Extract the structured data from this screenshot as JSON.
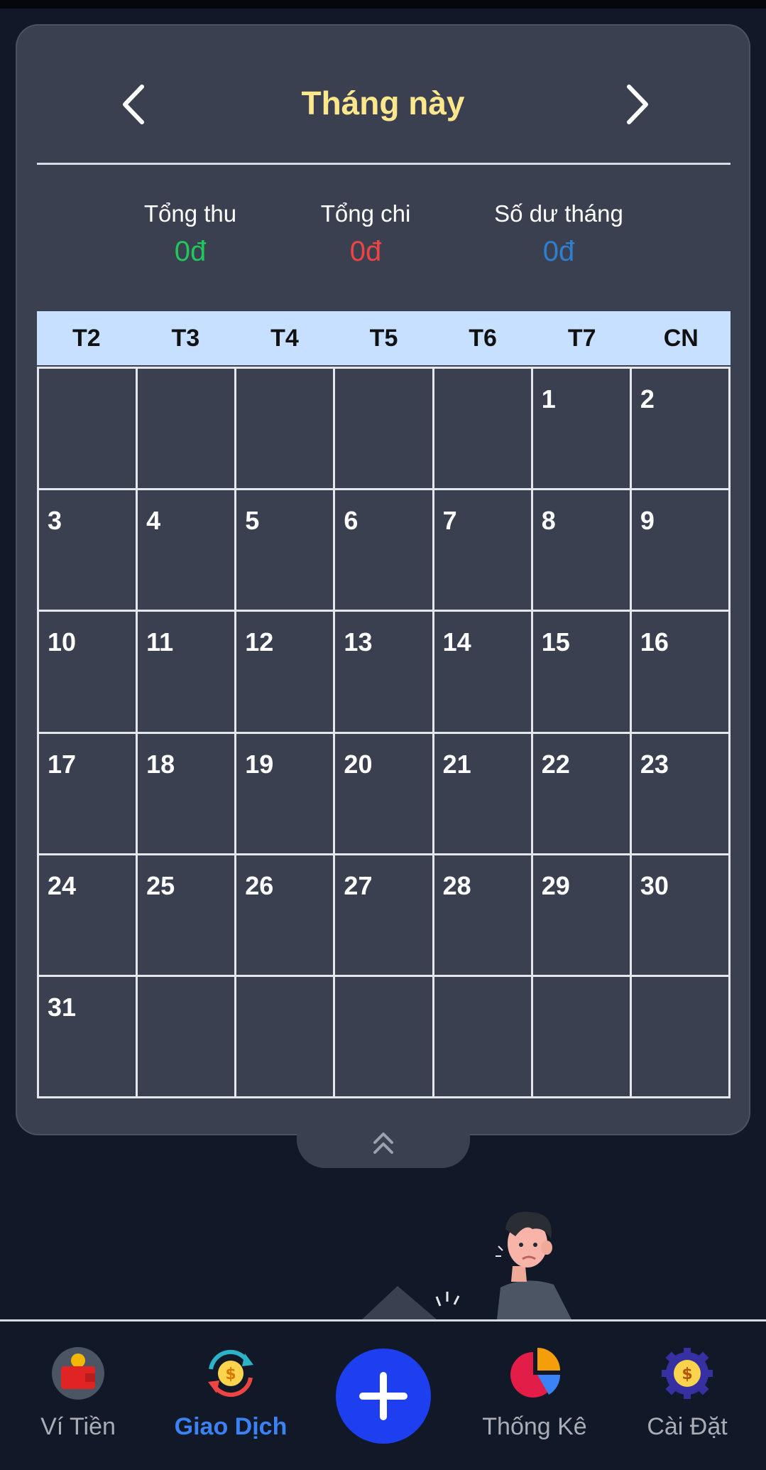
{
  "header": {
    "title": "Tháng này",
    "prev_icon": "chevron-left-icon",
    "next_icon": "chevron-right-icon"
  },
  "summary": {
    "income_label": "Tổng thu",
    "income_value": "0đ",
    "expense_label": "Tổng chi",
    "expense_value": "0đ",
    "balance_label": "Số dư tháng",
    "balance_value": "0đ"
  },
  "calendar": {
    "weekdays": [
      "T2",
      "T3",
      "T4",
      "T5",
      "T6",
      "T7",
      "CN"
    ],
    "days": [
      "",
      "",
      "",
      "",
      "",
      "1",
      "2",
      "3",
      "4",
      "5",
      "6",
      "7",
      "8",
      "9",
      "10",
      "11",
      "12",
      "13",
      "14",
      "15",
      "16",
      "17",
      "18",
      "19",
      "20",
      "21",
      "22",
      "23",
      "24",
      "25",
      "26",
      "27",
      "28",
      "29",
      "30",
      "31",
      "",
      "",
      "",
      "",
      "",
      ""
    ]
  },
  "bottom_nav": {
    "wallet": "Ví Tiền",
    "transactions": "Giao Dịch",
    "stats": "Thống Kê",
    "settings": "Cài Đặt",
    "add_icon": "plus-icon"
  },
  "colors": {
    "title": "#fce78c",
    "income": "#22c55e",
    "expense": "#ef4444",
    "balance": "#2e7fd0",
    "active_nav": "#3b82f6",
    "fab": "#1d3ff0"
  }
}
